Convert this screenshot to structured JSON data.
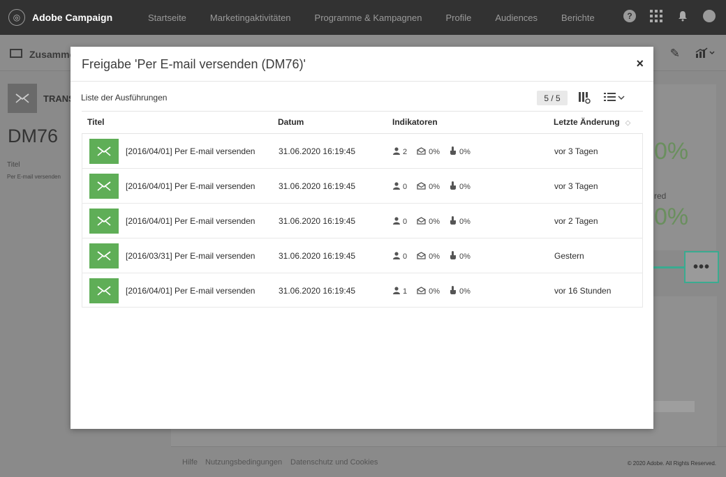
{
  "app": {
    "brand": "Adobe Campaign",
    "nav": [
      "Startseite",
      "Marketingaktivitäten",
      "Programme & Kampagnen",
      "Profile",
      "Audiences",
      "Berichte"
    ],
    "help_icon": "question-circle-icon",
    "apps_icon": "grid-icon",
    "notification_icon": "bell-icon",
    "avatar_icon": "user-avatar-icon"
  },
  "background": {
    "subtitle": "Zusamme",
    "type_label": "TRANS",
    "delivery_code": "DM76",
    "label_title": "Titel",
    "label_value": "Per E-mail versenden",
    "pct1": "0%",
    "red_label": "red",
    "pct2": "0%",
    "dots": "•••"
  },
  "footer": {
    "links": [
      "Hilfe",
      "Nutzungsbedingungen",
      "Datenschutz und Cookies"
    ],
    "copyright": "© 2020 Adobe. All Rights Reserved."
  },
  "modal": {
    "title": "Freigabe 'Per E-mail versenden (DM76)'",
    "close": "×",
    "list_label": "Liste der Ausführungen",
    "counter": "5 / 5",
    "columns": [
      "Titel",
      "Datum",
      "Indikatoren",
      "Letzte Änderung"
    ],
    "rows": [
      {
        "title": "[2016/04/01] Per E-mail versenden",
        "date": "31.06.2020 16:19:45",
        "count": "2",
        "open": "0%",
        "click": "0%",
        "modified": "vor 3 Tagen"
      },
      {
        "title": "[2016/04/01]  Per E-mail versenden",
        "date": "31.06.2020 16:19:45",
        "count": "0",
        "open": "0%",
        "click": "0%",
        "modified": "vor 3 Tagen"
      },
      {
        "title": "[2016/04/01] Per E-mail versenden",
        "date": "31.06.2020 16:19:45",
        "count": "0",
        "open": "0%",
        "click": "0%",
        "modified": "vor 2 Tagen"
      },
      {
        "title": "[2016/03/31] Per E-mail versenden",
        "date": "31.06.2020 16:19:45",
        "count": "0",
        "open": "0%",
        "click": "0%",
        "modified": "Gestern"
      },
      {
        "title": "[2016/04/01] Per E-mail versenden",
        "date": "31.06.2020 16:19:45",
        "count": "1",
        "open": "0%",
        "click": "0%",
        "modified": "vor 16 Stunden"
      }
    ]
  },
  "colors": {
    "accent_teal": "#3aab90",
    "email_green": "#5fae57",
    "nav_bg": "#323232"
  }
}
